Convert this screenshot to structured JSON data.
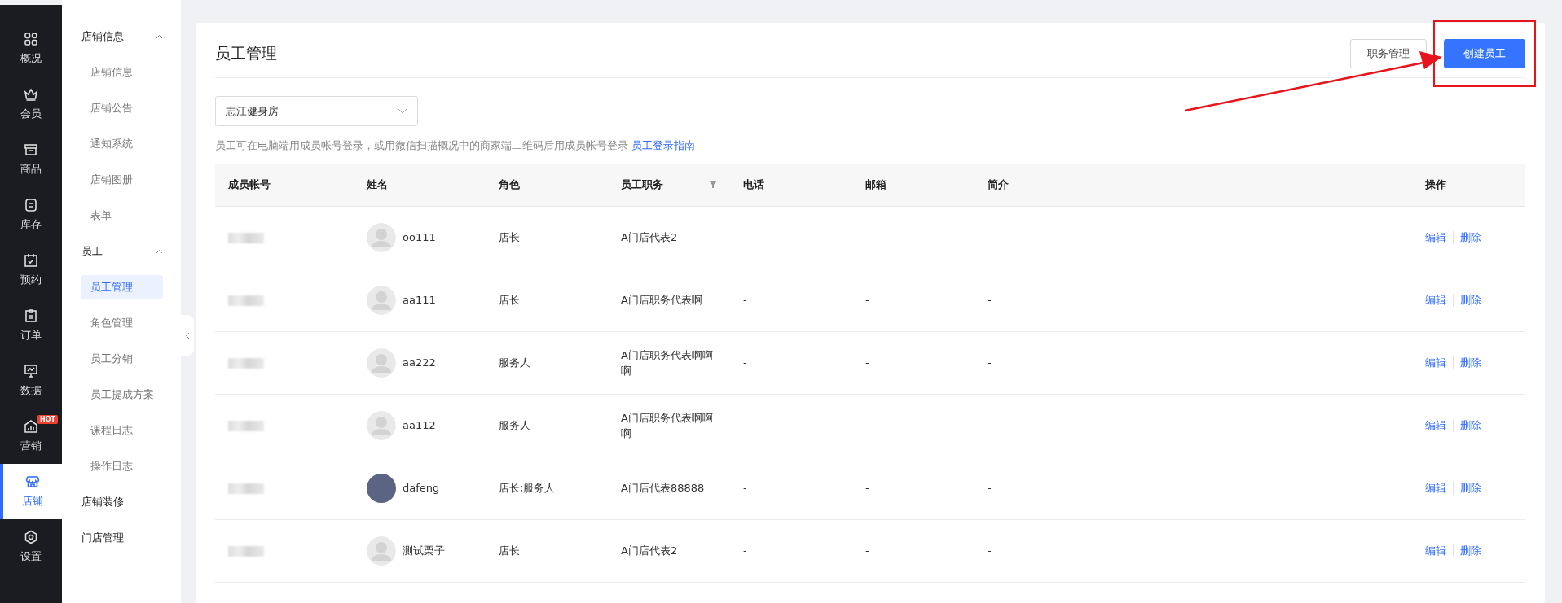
{
  "main_nav": [
    {
      "label": "概况",
      "selected": false
    },
    {
      "label": "会员",
      "selected": false
    },
    {
      "label": "商品",
      "selected": false
    },
    {
      "label": "库存",
      "selected": false
    },
    {
      "label": "预约",
      "selected": false
    },
    {
      "label": "订单",
      "selected": false
    },
    {
      "label": "数据",
      "selected": false
    },
    {
      "label": "营销",
      "selected": false,
      "badge": "HOT"
    },
    {
      "label": "店铺",
      "selected": true
    },
    {
      "label": "设置",
      "selected": false
    }
  ],
  "sub_nav": [
    {
      "label": "店铺信息",
      "expanded": true,
      "children": [
        {
          "label": "店铺信息",
          "selected": false
        },
        {
          "label": "店铺公告",
          "selected": false
        },
        {
          "label": "通知系统",
          "selected": false
        },
        {
          "label": "店铺图册",
          "selected": false
        },
        {
          "label": "表单",
          "selected": false
        }
      ]
    },
    {
      "label": "员工",
      "expanded": true,
      "children": [
        {
          "label": "员工管理",
          "selected": true
        },
        {
          "label": "角色管理",
          "selected": false
        },
        {
          "label": "员工分销",
          "selected": false
        },
        {
          "label": "员工提成方案",
          "selected": false
        },
        {
          "label": "课程日志",
          "selected": false
        },
        {
          "label": "操作日志",
          "selected": false
        }
      ]
    },
    {
      "label": "店铺装修"
    },
    {
      "label": "门店管理"
    }
  ],
  "page": {
    "title": "员工管理",
    "buttons": [
      {
        "label": "职务管理",
        "kind": "default"
      },
      {
        "label": "创建员工",
        "kind": "primary"
      }
    ],
    "store_select": {
      "value": "志江健身房"
    },
    "hint": {
      "text": "员工可在电脑端用成员帐号登录，或用微信扫描概况中的商家端二维码后用成员帐号登录",
      "link": "员工登录指南"
    },
    "table": {
      "columns": [
        {
          "label": "成员帐号"
        },
        {
          "label": "姓名"
        },
        {
          "label": "角色"
        },
        {
          "label": "员工职务",
          "filter": true
        },
        {
          "label": "电话"
        },
        {
          "label": "邮箱"
        },
        {
          "label": "简介"
        },
        {
          "label": "操作"
        }
      ],
      "rows": [
        {
          "name": "oo111",
          "kind": "default_avatar",
          "role": "店长",
          "position": "A门店代表2",
          "phone": "-",
          "email": "-",
          "intro": "-",
          "actions": [
            "编辑",
            "删除"
          ]
        },
        {
          "name": "aa111",
          "kind": "default_avatar",
          "role": "店长",
          "position": "A门店职务代表啊",
          "phone": "-",
          "email": "-",
          "intro": "-",
          "actions": [
            "编辑",
            "删除"
          ]
        },
        {
          "name": "aa222",
          "kind": "default_avatar",
          "role": "服务人",
          "position": "A门店职务代表啊啊啊",
          "phone": "-",
          "email": "-",
          "intro": "-",
          "actions": [
            "编辑",
            "删除"
          ]
        },
        {
          "name": "aa112",
          "kind": "default_avatar",
          "role": "服务人",
          "position": "A门店职务代表啊啊啊",
          "phone": "-",
          "email": "-",
          "intro": "-",
          "actions": [
            "编辑",
            "删除"
          ]
        },
        {
          "name": "dafeng",
          "kind": "photo_avatar",
          "role": "店长;服务人",
          "position": "A门店代表88888",
          "phone": "-",
          "email": "-",
          "intro": "-",
          "actions": [
            "编辑",
            "删除"
          ]
        },
        {
          "name": "测试栗子",
          "kind": "default_avatar",
          "role": "店长",
          "position": "A门店代表2",
          "phone": "-",
          "email": "-",
          "intro": "-",
          "actions": [
            "编辑",
            "删除"
          ]
        }
      ]
    }
  }
}
